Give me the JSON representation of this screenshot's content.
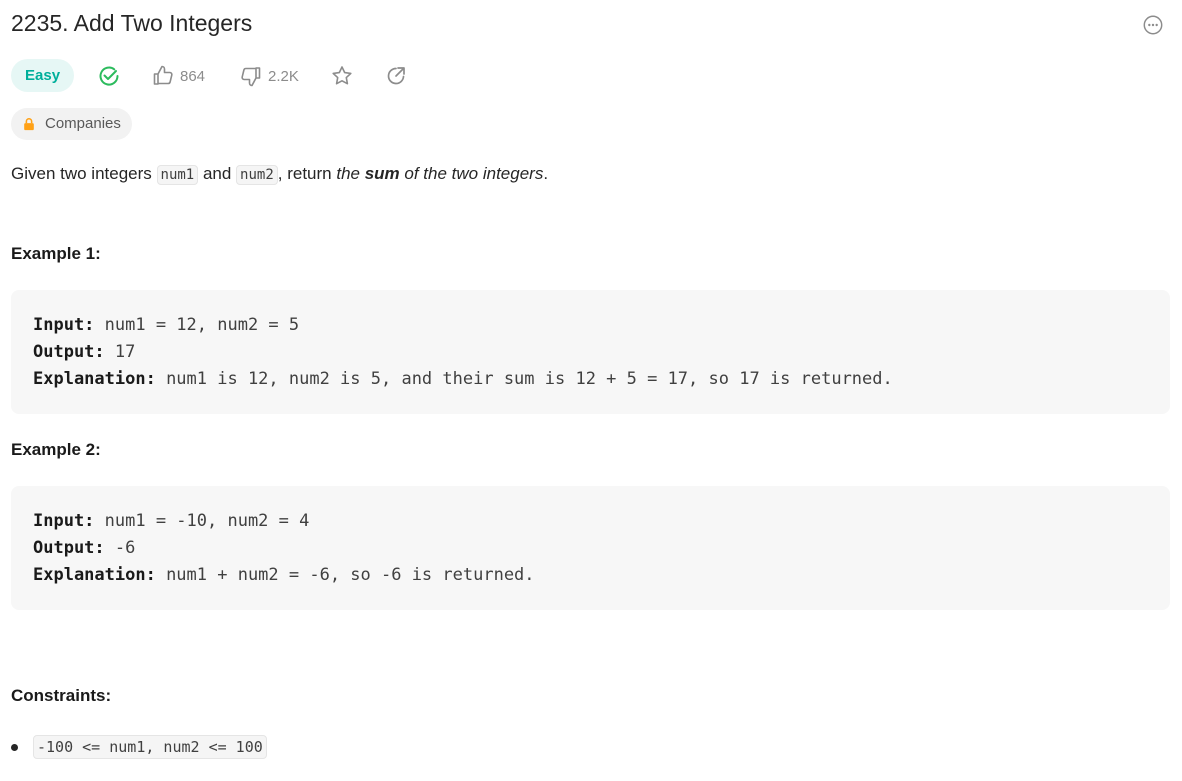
{
  "problem": {
    "title": "2235. Add Two Integers",
    "difficulty": "Easy",
    "likes": "864",
    "dislikes": "2.2K",
    "companies_label": "Companies"
  },
  "description": {
    "part1": "Given two integers ",
    "code1": "num1",
    "part2": " and ",
    "code2": "num2",
    "part3": ", return ",
    "italic1": "the ",
    "bold": "sum",
    "italic2": " of the two integers",
    "end": "."
  },
  "examples": [
    {
      "heading": "Example 1:",
      "input_label": "Input:",
      "input": " num1 = 12, num2 = 5",
      "output_label": "Output:",
      "output": " 17",
      "explanation_label": "Explanation:",
      "explanation": " num1 is 12, num2 is 5, and their sum is 12 + 5 = 17, so 17 is returned."
    },
    {
      "heading": "Example 2:",
      "input_label": "Input:",
      "input": " num1 = -10, num2 = 4",
      "output_label": "Output:",
      "output": " -6",
      "explanation_label": "Explanation:",
      "explanation": " num1 + num2 = -6, so -6 is returned."
    }
  ],
  "constraints": {
    "heading": "Constraints:",
    "items": [
      "-100 <= num1, num2 <= 100"
    ]
  },
  "colors": {
    "easy_bg": "#e6f7f5",
    "easy_text": "#00af9b",
    "solved_green": "#2cbb5d",
    "lock_orange": "#ffa116"
  },
  "icons": [
    "more-icon",
    "solved-check-icon",
    "thumbs-up-icon",
    "thumbs-down-icon",
    "star-icon",
    "share-icon",
    "lock-icon"
  ]
}
